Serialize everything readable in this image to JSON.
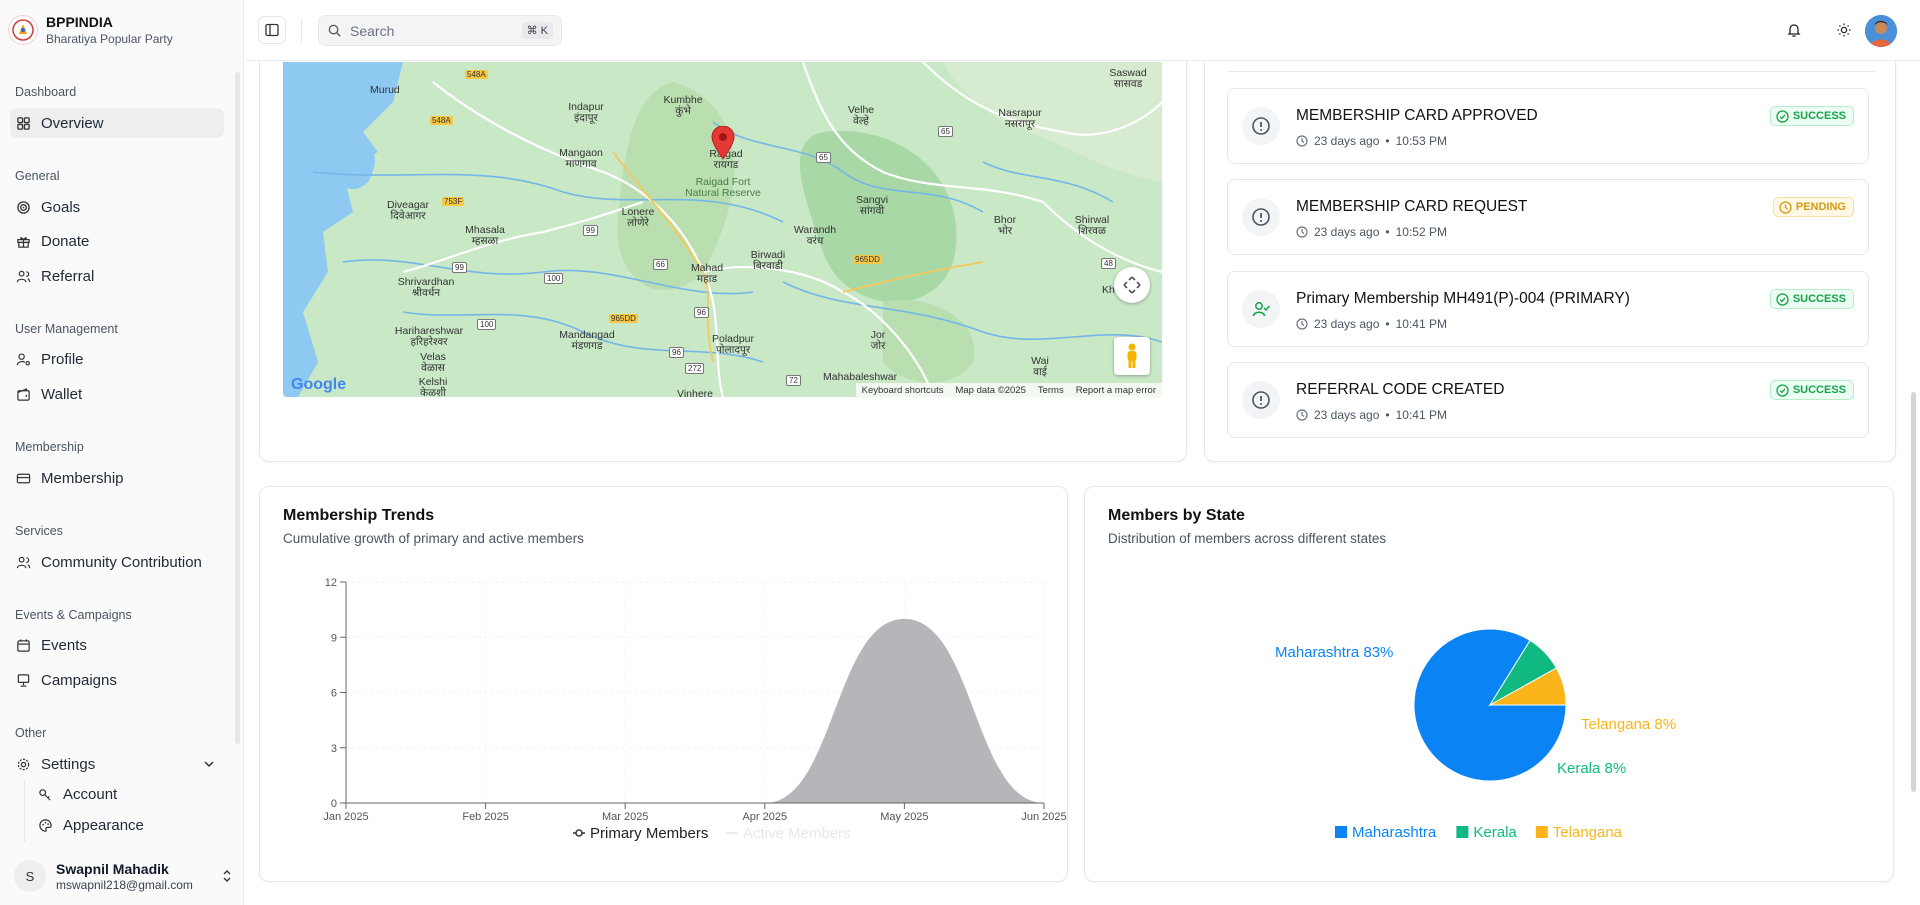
{
  "brand": {
    "name": "BPPINDIA",
    "subtitle": "Bharatiya Popular Party"
  },
  "sidebar": {
    "sections": [
      "Dashboard",
      "General",
      "User Management",
      "Membership",
      "Services",
      "Events & Campaigns",
      "Other"
    ],
    "items": {
      "overview": "Overview",
      "goals": "Goals",
      "donate": "Donate",
      "referral": "Referral",
      "profile": "Profile",
      "wallet": "Wallet",
      "membership": "Membership",
      "community": "Community Contribution",
      "events": "Events",
      "campaigns": "Campaigns",
      "settings": "Settings",
      "account": "Account",
      "appearance": "Appearance"
    },
    "user": {
      "initial": "S",
      "name": "Swapnil Mahadik",
      "email": "mswapnil218@gmail.com"
    }
  },
  "topbar": {
    "search_placeholder": "Search",
    "shortcut": "⌘ K"
  },
  "map": {
    "labels": [
      "Murud",
      "Indapur इंदापूर",
      "Kumbhe कुंभे",
      "Raigad रायगड",
      "Raigad Fort Natural Reserve",
      "Velhe वेल्हे",
      "Nasrapur नसरापूर",
      "Saswad सासवड",
      "Mangaon माणगाव",
      "Diveagar दिवेआगर",
      "Mhasala म्हसळा",
      "Lonere लोणेरे",
      "Warandh वरंध",
      "Sangvi सांगवी",
      "Bhor भोर",
      "Shirwal शिरवळ",
      "Shrivardhan श्रीवर्धन",
      "Mahad महाड",
      "Birwadi बिरवाडी",
      "Harihareshwar हरिहरेश्वर",
      "Velas वेळास",
      "Mandangad मंडणगड",
      "Poladpur पोलादपूर",
      "Jor जोर",
      "Kelshi केळशी",
      "Mahabaleshwar",
      "Wai वाई",
      "Vinhere",
      "Kh"
    ],
    "badges": [
      "548A",
      "548A",
      "753F",
      "965DD",
      "965DD"
    ],
    "roads": [
      "65",
      "65",
      "99",
      "99",
      "100",
      "100",
      "66",
      "96",
      "96",
      "272",
      "72",
      "48"
    ],
    "footer": [
      "Keyboard shortcuts",
      "Map data ©2025",
      "Terms",
      "Report a map error"
    ],
    "logo": "Google"
  },
  "activity": [
    {
      "title": "MEMBERSHIP CARD APPROVED",
      "time_ago": "23 days ago",
      "time": "10:53 PM",
      "status": "SUCCESS",
      "icon": "alert-circle-icon"
    },
    {
      "title": "MEMBERSHIP CARD REQUEST",
      "time_ago": "23 days ago",
      "time": "10:52 PM",
      "status": "PENDING",
      "icon": "alert-circle-icon"
    },
    {
      "title": "Primary Membership MH491(P)-004 (PRIMARY)",
      "time_ago": "23 days ago",
      "time": "10:41 PM",
      "status": "SUCCESS",
      "icon": "user-check-icon"
    },
    {
      "title": "REFERRAL CODE CREATED",
      "time_ago": "23 days ago",
      "time": "10:41 PM",
      "status": "SUCCESS",
      "icon": "alert-circle-icon"
    }
  ],
  "trends": {
    "title": "Membership Trends",
    "subtitle": "Cumulative growth of primary and active members"
  },
  "states": {
    "title": "Members by State",
    "subtitle": "Distribution of members across different states"
  },
  "chart_data": [
    {
      "type": "area",
      "title": "Membership Trends",
      "x": [
        "Jan 2025",
        "Feb 2025",
        "Mar 2025",
        "Apr 2025",
        "May 2025",
        "Jun 2025"
      ],
      "series": [
        {
          "name": "Primary Members",
          "values": [
            0,
            0,
            0,
            0,
            10,
            0
          ],
          "color": "#b6b6ba"
        },
        {
          "name": "Active Members",
          "values": [
            0,
            0,
            0,
            0,
            0,
            0
          ],
          "color": "#e5e7eb"
        }
      ],
      "yticks": [
        0,
        3,
        6,
        9,
        12
      ],
      "ylim": [
        0,
        12
      ],
      "legend": "bottom"
    },
    {
      "type": "pie",
      "title": "Members by State",
      "slices": [
        {
          "label": "Maharashtra",
          "value": 83,
          "text": "Maharashtra 83%",
          "color": "#0a84f5"
        },
        {
          "label": "Kerala",
          "value": 8,
          "text": "Kerala 8%",
          "color": "#10b981"
        },
        {
          "label": "Telangana",
          "value": 8,
          "text": "Telangana 8%",
          "color": "#fbb41a"
        }
      ],
      "legend": "bottom"
    }
  ]
}
